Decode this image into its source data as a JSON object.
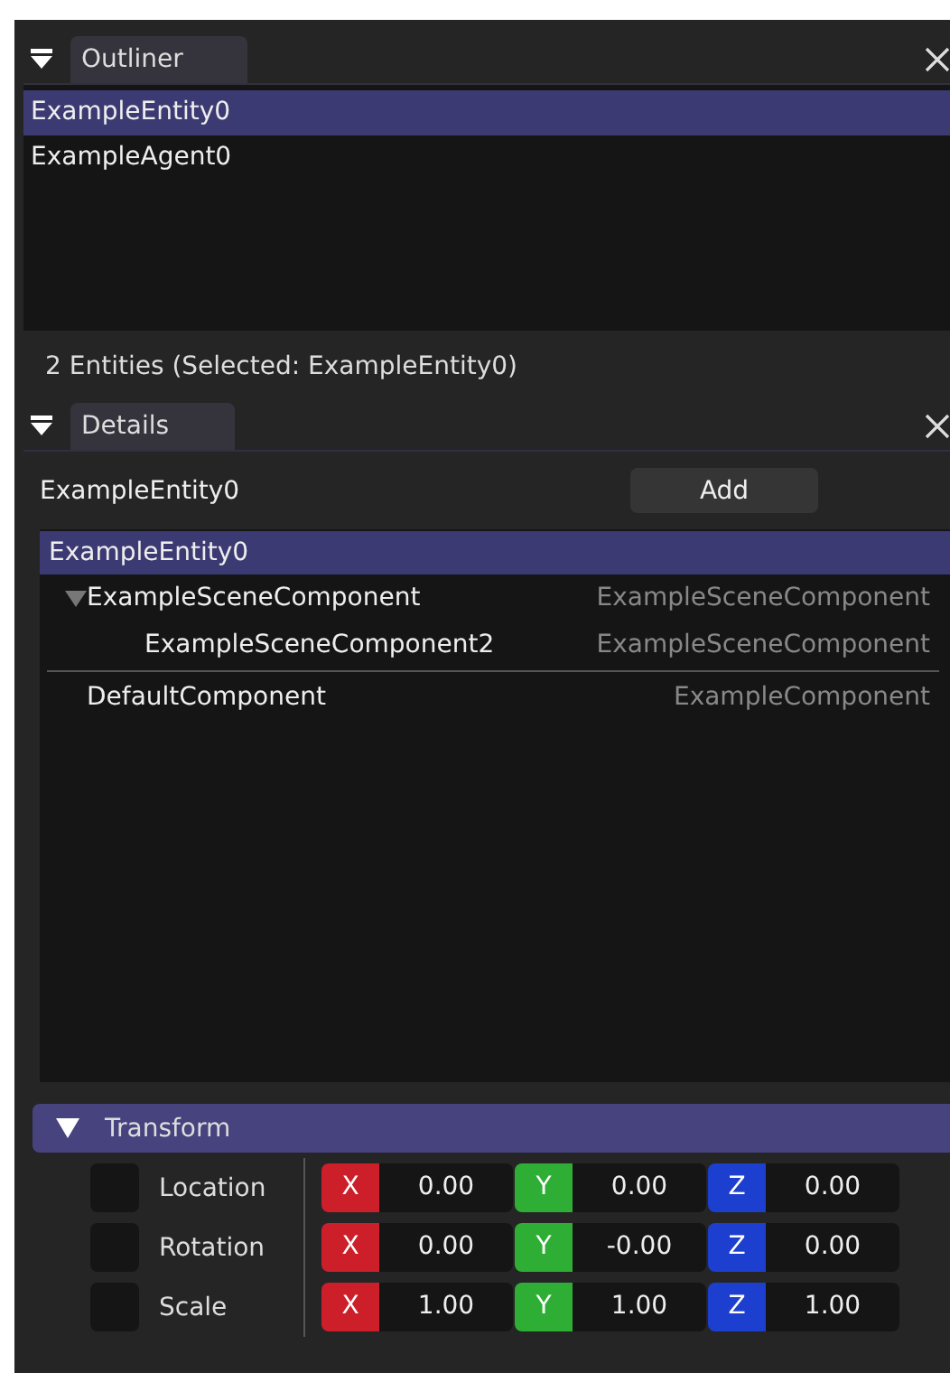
{
  "outliner": {
    "tab": "Outliner",
    "entities": [
      {
        "name": "ExampleEntity0",
        "selected": true
      },
      {
        "name": "ExampleAgent0",
        "selected": false
      }
    ],
    "status": "2 Entities (Selected: ExampleEntity0)"
  },
  "details": {
    "tab": "Details",
    "entity_name": "ExampleEntity0",
    "add_button": "Add",
    "tree": {
      "name": "ExampleEntity0",
      "selected": true,
      "scene_components": [
        {
          "name": "ExampleSceneComponent",
          "type": "ExampleSceneComponent",
          "expanded": true,
          "children": [
            {
              "name": "ExampleSceneComponent2",
              "type": "ExampleSceneComponent"
            }
          ]
        }
      ],
      "components": [
        {
          "name": "DefaultComponent",
          "type": "ExampleComponent"
        }
      ]
    },
    "transform": {
      "title": "Transform",
      "expanded": true,
      "rows": [
        {
          "label": "Location",
          "checked": false,
          "fields": [
            {
              "axis": "X",
              "color": "#cc1f2a",
              "value": "0.00"
            },
            {
              "axis": "Y",
              "color": "#2fae35",
              "value": "0.00"
            },
            {
              "axis": "Z",
              "color": "#1d3fcf",
              "value": "0.00"
            }
          ]
        },
        {
          "label": "Rotation",
          "checked": false,
          "fields": [
            {
              "axis": "X",
              "color": "#cc1f2a",
              "value": "0.00"
            },
            {
              "axis": "Y",
              "color": "#2fae35",
              "value": "-0.00"
            },
            {
              "axis": "Z",
              "color": "#1d3fcf",
              "value": "0.00"
            }
          ]
        },
        {
          "label": "Scale",
          "checked": false,
          "fields": [
            {
              "axis": "X",
              "color": "#cc1f2a",
              "value": "1.00"
            },
            {
              "axis": "Y",
              "color": "#2fae35",
              "value": "1.00"
            },
            {
              "axis": "Z",
              "color": "#1d3fcf",
              "value": "1.00"
            }
          ]
        }
      ]
    }
  }
}
